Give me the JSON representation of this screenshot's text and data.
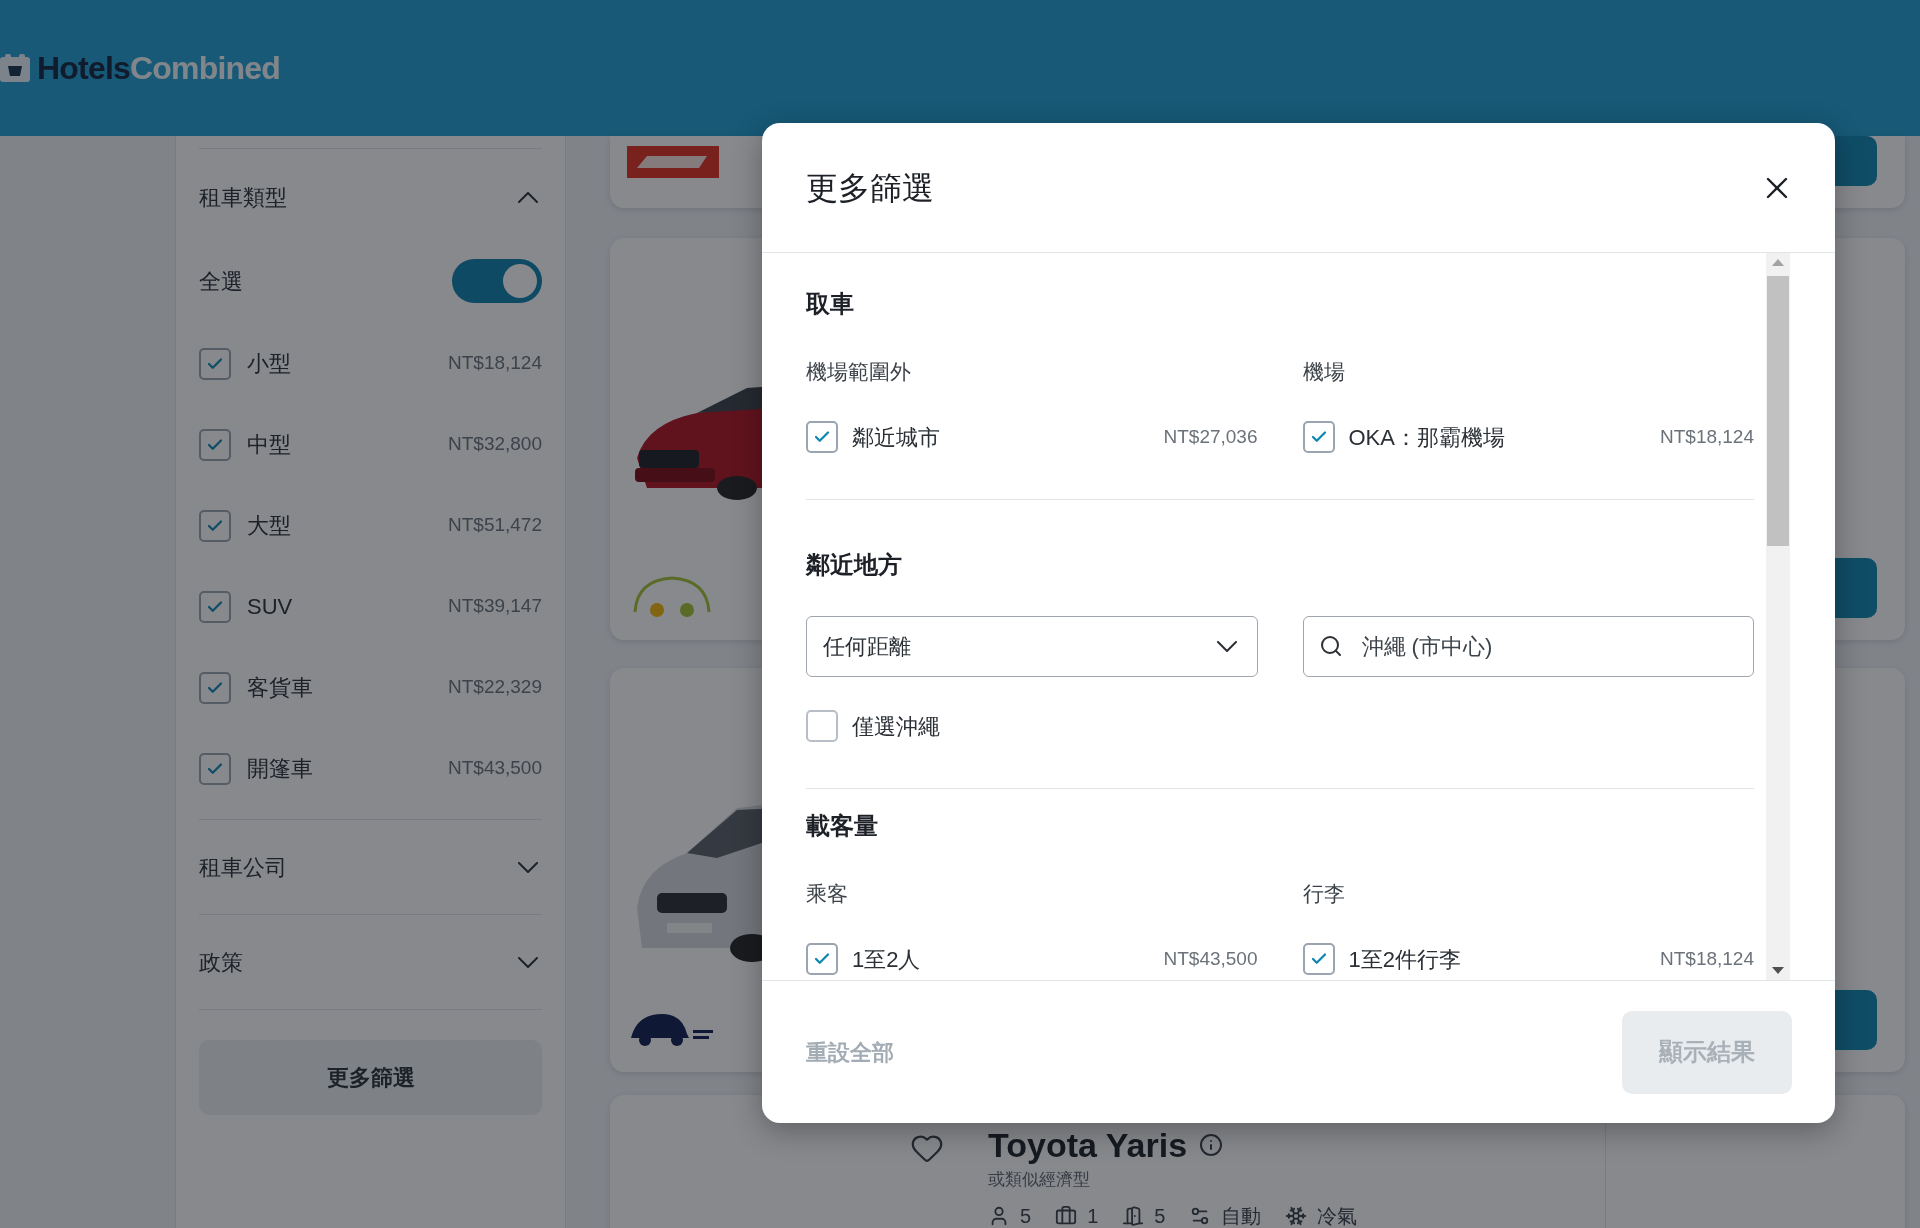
{
  "header": {
    "logo_dark": "Hotels",
    "logo_light": "Combined"
  },
  "sidebar": {
    "sections": [
      {
        "title": "租車類型",
        "expanded": true,
        "select_all": {
          "label": "全選",
          "on": true
        },
        "options": [
          {
            "label": "小型",
            "price": "NT$18,124",
            "checked": true
          },
          {
            "label": "中型",
            "price": "NT$32,800",
            "checked": true
          },
          {
            "label": "大型",
            "price": "NT$51,472",
            "checked": true
          },
          {
            "label": "SUV",
            "price": "NT$39,147",
            "checked": true
          },
          {
            "label": "客貨車",
            "price": "NT$22,329",
            "checked": true
          },
          {
            "label": "開篷車",
            "price": "NT$43,500",
            "checked": true
          }
        ]
      },
      {
        "title": "租車公司",
        "expanded": false
      },
      {
        "title": "政策",
        "expanded": false
      }
    ],
    "more_button": "更多篩選"
  },
  "results": [
    {
      "kind": "logo-strip"
    },
    {
      "kind": "sedan"
    },
    {
      "kind": "van"
    },
    {
      "kind": "listing",
      "name": "Toyota Yaris",
      "subtitle": "或類似經濟型",
      "specs": [
        "5",
        "1",
        "5",
        "自動",
        "冷氣"
      ]
    }
  ],
  "modal": {
    "title": "更多篩選",
    "sections": [
      {
        "kind": "columns",
        "title": "取車",
        "columns": [
          {
            "label": "機場範圍外",
            "options": [
              {
                "label": "鄰近城市",
                "price": "NT$27,036",
                "checked": true
              }
            ]
          },
          {
            "label": "機場",
            "options": [
              {
                "label": "OKA：那霸機場",
                "price": "NT$18,124",
                "checked": true
              }
            ]
          }
        ]
      },
      {
        "kind": "location",
        "title": "鄰近地方",
        "distance": "任何距離",
        "search_value": "沖繩 (市中心)",
        "only": {
          "label": "僅選沖繩",
          "checked": false
        }
      },
      {
        "kind": "columns",
        "title": "載客量",
        "columns": [
          {
            "label": "乘客",
            "options": [
              {
                "label": "1至2人",
                "price": "NT$43,500",
                "checked": true
              }
            ]
          },
          {
            "label": "行李",
            "options": [
              {
                "label": "1至2件行李",
                "price": "NT$18,124",
                "checked": true
              }
            ]
          }
        ]
      }
    ],
    "reset": "重設全部",
    "apply": {
      "label": "顯示結果",
      "disabled": true
    }
  }
}
